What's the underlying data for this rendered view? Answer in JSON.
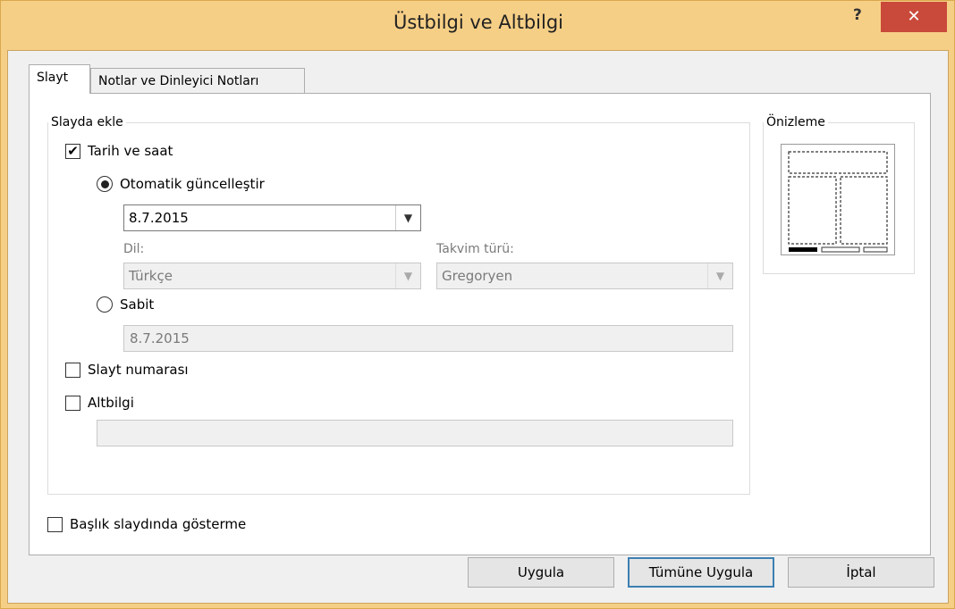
{
  "window": {
    "title": "Üstbilgi ve Altbilgi",
    "help": "?",
    "close": "✕"
  },
  "tabs": [
    {
      "label": "Slayt"
    },
    {
      "label": "Notlar ve Dinleyici Notları"
    }
  ],
  "slide_group": {
    "legend": "Slayda ekle",
    "date_time": {
      "label": "Tarih ve saat",
      "checked": true
    },
    "auto_update": {
      "label": "Otomatik güncelleştir",
      "selected": true,
      "value": "8.7.2015"
    },
    "language": {
      "label": "Dil:",
      "value": "Türkçe"
    },
    "calendar": {
      "label": "Takvim türü:",
      "value": "Gregoryen"
    },
    "fixed": {
      "label": "Sabit",
      "selected": false,
      "value": "8.7.2015"
    },
    "slide_number": {
      "label": "Slayt numarası",
      "checked": false
    },
    "footer": {
      "label": "Altbilgi",
      "checked": false,
      "value": ""
    }
  },
  "preview": {
    "legend": "Önizleme"
  },
  "dont_show_title": {
    "label": "Başlık slaydında gösterme",
    "checked": false
  },
  "buttons": {
    "apply": "Uygula",
    "apply_all": "Tümüne Uygula",
    "cancel": "İptal"
  }
}
